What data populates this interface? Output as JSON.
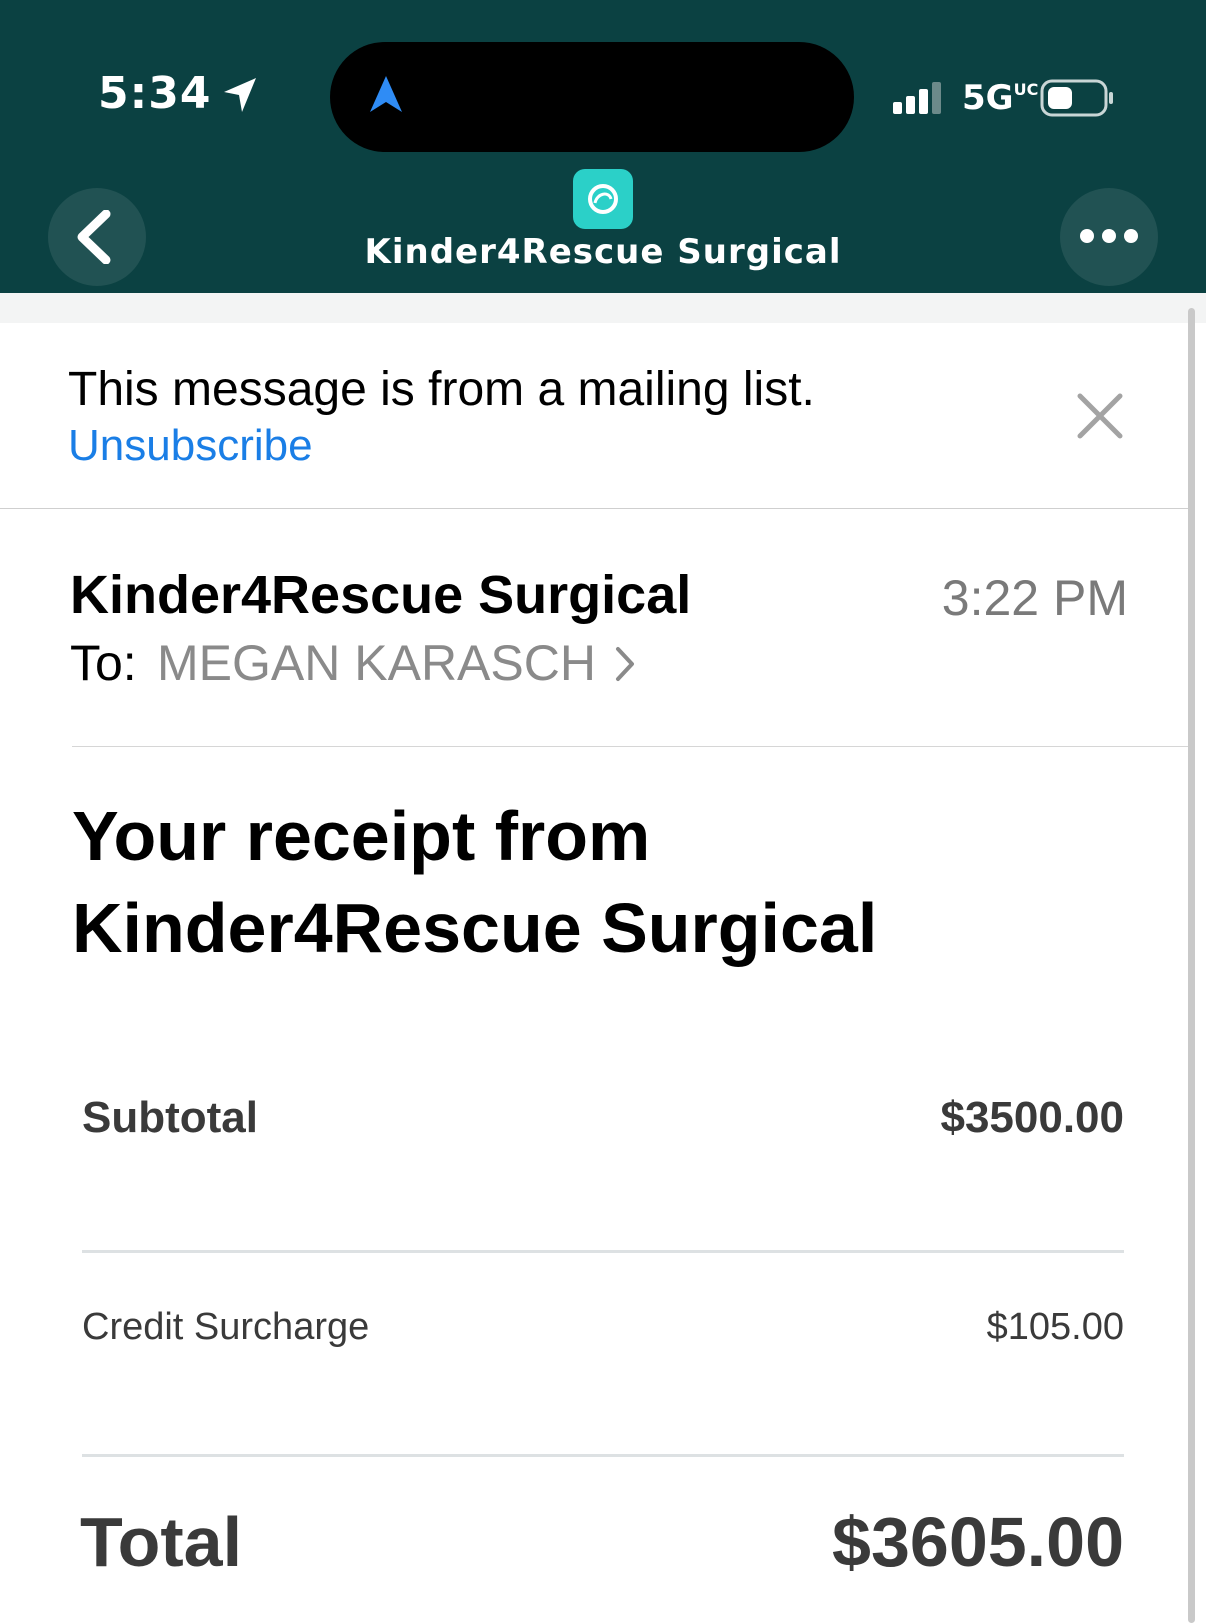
{
  "status_bar": {
    "time": "5:34",
    "network": "5G",
    "network_suffix": "UC",
    "location_icon": "location-arrow-icon",
    "signal_icon": "cellular-signal-icon",
    "battery_icon": "battery-icon",
    "island_icon": "navigation-arrow-icon"
  },
  "header": {
    "title": "Kinder4Rescue Surgical",
    "back_icon": "chevron-left-icon",
    "more_icon": "ellipsis-icon",
    "app_icon": "app-logo-icon",
    "background_color": "#0b4142"
  },
  "banner": {
    "message": "This message is from a mailing list.",
    "unsubscribe_label": "Unsubscribe",
    "close_icon": "close-icon",
    "link_color": "#1a7ee6"
  },
  "email": {
    "sender": "Kinder4Rescue Surgical",
    "time": "3:22 PM",
    "to_label": "To:",
    "to_name": "MEGAN KARASCH"
  },
  "receipt": {
    "title": "Your receipt from Kinder4Rescue Surgical",
    "subtotal_label": "Subtotal",
    "subtotal_value": "$3500.00",
    "surcharge_label": "Credit Surcharge",
    "surcharge_value": "$105.00",
    "total_label": "Total",
    "total_value": "$3605.00"
  }
}
